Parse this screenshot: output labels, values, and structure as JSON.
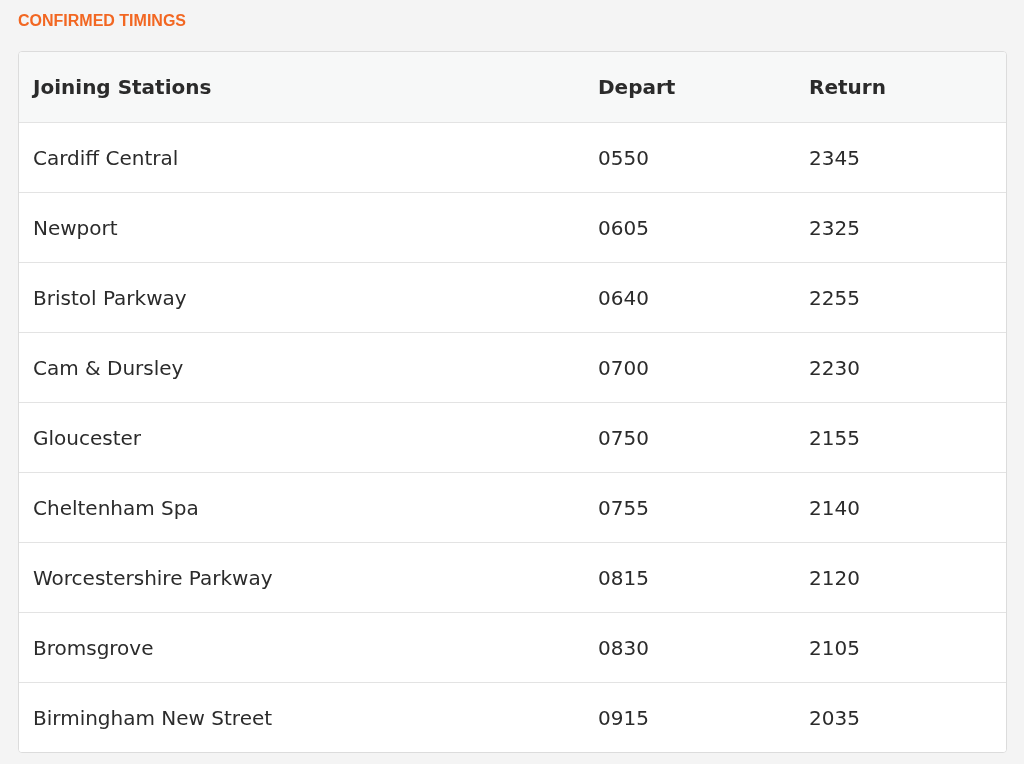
{
  "section_title": "CONFIRMED TIMINGS",
  "table": {
    "columns": [
      "Joining Stations",
      "Depart",
      "Return"
    ],
    "rows": [
      [
        "Cardiff Central",
        "0550",
        "2345"
      ],
      [
        "Newport",
        "0605",
        "2325"
      ],
      [
        "Bristol Parkway",
        "0640",
        "2255"
      ],
      [
        "Cam & Dursley",
        "0700",
        "2230"
      ],
      [
        "Gloucester",
        "0750",
        "2155"
      ],
      [
        "Cheltenham Spa",
        "0755",
        "2140"
      ],
      [
        "Worcestershire Parkway",
        "0815",
        "2120"
      ],
      [
        "Bromsgrove",
        "0830",
        "2105"
      ],
      [
        "Birmingham New Street",
        "0915",
        "2035"
      ]
    ]
  }
}
